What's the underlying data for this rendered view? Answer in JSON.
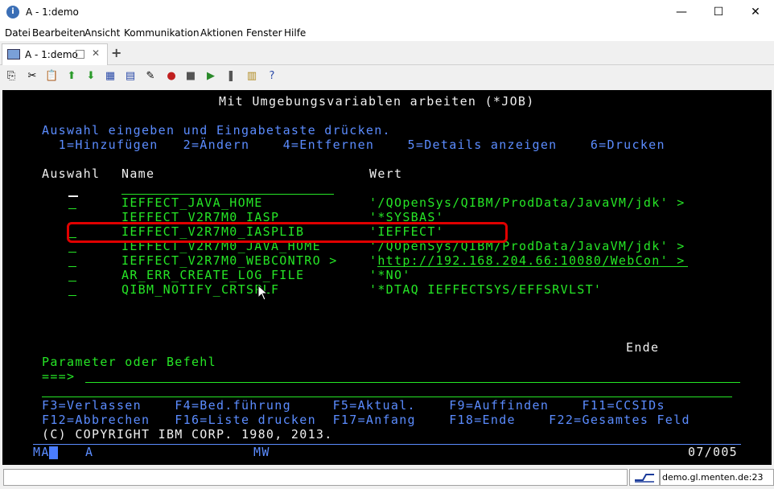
{
  "window": {
    "title": "A - 1:demo",
    "minimize": "—",
    "maximize": "☐",
    "close": "✕"
  },
  "menu": [
    "Datei",
    "Bearbeiten",
    "Ansicht",
    "Kommunikation",
    "Aktionen",
    "Fenster",
    "Hilfe"
  ],
  "tab": {
    "label": "A - 1:demo",
    "close": "✕",
    "add": "+"
  },
  "toolbar": [
    "copy-icon",
    "cut-icon",
    "paste-icon",
    "upload-icon",
    "download-icon",
    "keyboard-icon",
    "grid-icon",
    "macro-icon",
    "record-icon",
    "stop-icon",
    "play-icon",
    "pause-icon",
    "notes-icon",
    "help-icon"
  ],
  "terminal": {
    "title": "Mit Umgebungsvariablen arbeiten (*JOB)",
    "instructions": "Auswahl eingeben und Eingabetaste drücken.",
    "options": "  1=Hinzufügen   2=Ändern    4=Entfernen    5=Details anzeigen    6=Drucken",
    "col_auswahl": "Auswahl",
    "col_name": "Name",
    "col_wert": "Wert",
    "rows": [
      {
        "name": "IEFFECT_JAVA_HOME",
        "value": "'/QOpenSys/QIBM/ProdData/JavaVM/jdk' >"
      },
      {
        "name": "IEFFECT_V2R7M0_IASP",
        "value": "'*SYSBAS'"
      },
      {
        "name": "IEFFECT_V2R7M0_IASPLIB",
        "value": "'IEFFECT'"
      },
      {
        "name": "IEFFECT_V2R7M0_JAVA_HOME",
        "value": "'/QOpenSys/QIBM/ProdData/JavaVM/jdk' >"
      },
      {
        "name": "IEFFECT_V2R7M0_WEBCONTRO >",
        "value": "'http://192.168.204.66:10080/WebCon' >"
      },
      {
        "name": "AR_ERR_CREATE_LOG_FILE",
        "value": "'*NO'"
      },
      {
        "name": "QIBM_NOTIFY_CRTSPLF",
        "value": "'*DTAQ IEFFECTSYS/EFFSRVLST'"
      }
    ],
    "ende": "Ende",
    "param_label": "Parameter oder Befehl",
    "prompt": "===>",
    "fkeys1": "F3=Verlassen    F4=Bed.führung     F5=Aktual.    F9=Auffinden    F11=CCSIDs",
    "fkeys2": "F12=Abbrechen   F16=Liste drucken  F17=Anfang    F18=Ende    F22=Gesamtes Feld",
    "copyright": "(C) COPYRIGHT IBM CORP. 1980, 2013.",
    "oia_left": "MA",
    "oia_a": "A",
    "oia_mw": "MW",
    "oia_pos": "07/005"
  },
  "status": {
    "host": "demo.gl.menten.de:23"
  }
}
